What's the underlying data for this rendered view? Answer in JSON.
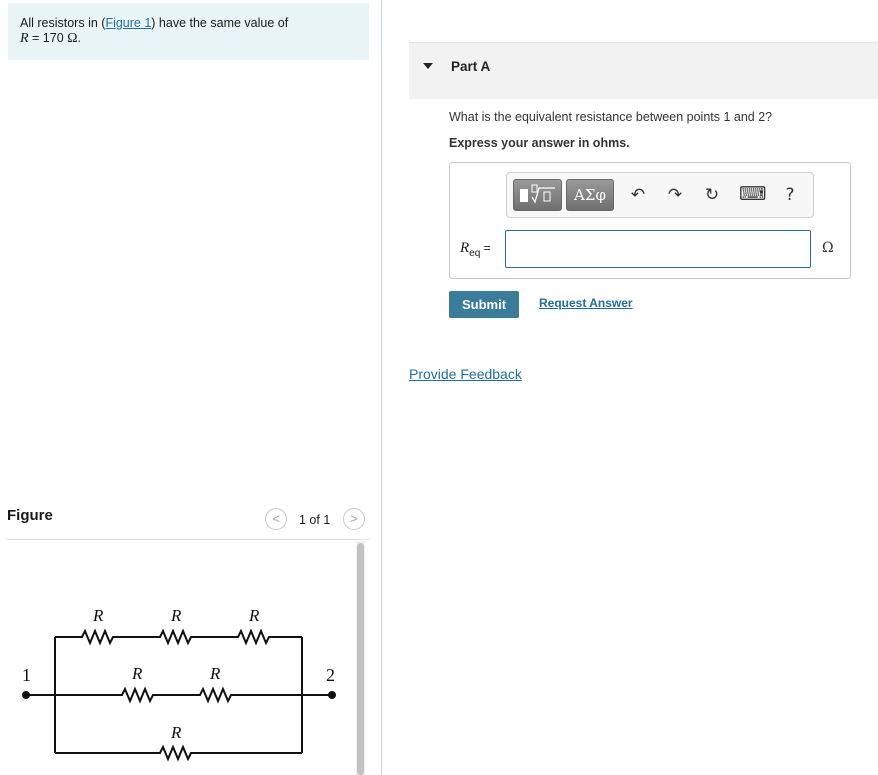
{
  "intro": {
    "prefix": "All resistors in (",
    "link": "Figure 1",
    "suffix": ") have the same value of",
    "var": "R",
    "equals": " = 170 ",
    "unit": "Ω",
    "end": "."
  },
  "figure": {
    "title": "Figure",
    "pager": "1 of 1",
    "prev": "<",
    "next": ">"
  },
  "circuit": {
    "resistor_label": "R",
    "node1": "1",
    "node2": "2"
  },
  "part": {
    "title": "Part A",
    "question": "What is the equivalent resistance between points 1 and 2?",
    "instruction": "Express your answer in ohms."
  },
  "toolbar": {
    "greek": "ΑΣφ",
    "undo": "↶",
    "redo": "↷",
    "reset": "↻",
    "keyboard": "⌨",
    "help": "?"
  },
  "answer": {
    "var": "R",
    "subscript": "eq",
    "equals": " =",
    "value": "",
    "unit": "Ω"
  },
  "actions": {
    "submit": "Submit",
    "request": "Request Answer",
    "feedback": "Provide Feedback"
  }
}
